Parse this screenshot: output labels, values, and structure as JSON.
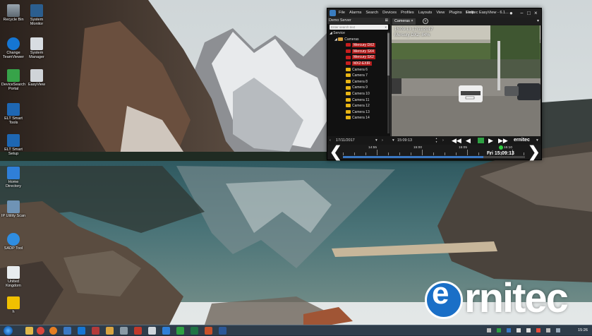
{
  "desktop": {
    "icons": [
      {
        "label": "Recycle Bin",
        "icon": "recycle-bin-icon"
      },
      {
        "label": "System Monitor",
        "icon": "monitor-icon"
      },
      {
        "label": "Change TeamViewer",
        "icon": "teamviewer-icon"
      },
      {
        "label": "System Manager",
        "icon": "system-manager-icon"
      },
      {
        "label": "DeviceSearch Portal",
        "icon": "device-search-icon"
      },
      {
        "label": "EasyView",
        "icon": "camera-icon"
      },
      {
        "label": "ELT Smart Tools",
        "icon": "tools-icon"
      },
      {
        "label": "ELT Smart Setup",
        "icon": "setup-icon"
      },
      {
        "label": "Home Directory",
        "icon": "home-icon"
      },
      {
        "label": "IP Utility Scan",
        "icon": "scanner-icon"
      },
      {
        "label": "SADP Tool",
        "icon": "sadp-icon"
      },
      {
        "label": "United Kingdom",
        "icon": "document-icon"
      },
      {
        "label": "h",
        "icon": "app-icon"
      }
    ]
  },
  "brand": {
    "logo_text": "ernitec",
    "initial": "e",
    "rest": "rnitec"
  },
  "window": {
    "menu": [
      "File",
      "Alarms",
      "Search",
      "Devices",
      "Profiles",
      "Layouts",
      "View",
      "Plugins",
      "Help"
    ],
    "title": "Ernitec EasyView - 6.1...",
    "controls": {
      "minimize": "−",
      "maximize": "□",
      "close": "×"
    },
    "tree": {
      "header": "Demo Server",
      "search_placeholder": "Enter search text",
      "search_clear": "×",
      "root": "Service",
      "folder": "Cameras",
      "cameras": [
        {
          "label": "Mercury DX2",
          "state": "active"
        },
        {
          "label": "Mercury SX4",
          "state": "active"
        },
        {
          "label": "Mercury SX2",
          "state": "active"
        },
        {
          "label": "MX2-EXIR",
          "state": "active"
        },
        {
          "label": "Camera 6",
          "state": "idle"
        },
        {
          "label": "Camera 7",
          "state": "idle"
        },
        {
          "label": "Camera 8",
          "state": "idle"
        },
        {
          "label": "Camera 9",
          "state": "idle"
        },
        {
          "label": "Camera 10",
          "state": "idle"
        },
        {
          "label": "Camera 11",
          "state": "idle"
        },
        {
          "label": "Camera 12",
          "state": "idle"
        },
        {
          "label": "Camera 13",
          "state": "idle"
        },
        {
          "label": "Camera 14",
          "state": "idle"
        }
      ]
    },
    "tab": {
      "label": "Cameras",
      "close": "×",
      "add": "+",
      "menu": "▾"
    },
    "video": {
      "osd_time": "15:09:13 17/11/2017",
      "osd_name": "Mercury DX2: 84%"
    },
    "playback": {
      "date": "17/11/2017",
      "time": "15:09:13",
      "prev_date": "‹",
      "date_menu": "▾",
      "next_date": "›",
      "time_menu": "▾",
      "step_up": "▲",
      "step_down": "▼",
      "next_time": "›",
      "buttons": {
        "rewind": "◀◀",
        "step_back": "◀",
        "play": "▶",
        "forward": "▶▶"
      },
      "logo": "ernitec",
      "logo_menu": "▾"
    },
    "timeline": {
      "labels": [
        "14:55",
        "15:00",
        "15:05",
        "15:10"
      ],
      "current": "Fri 15:09:13",
      "prev": "❮",
      "next": "❯",
      "progress": 0.77
    }
  },
  "taskbar": {
    "clock": "15:26",
    "pinned": [
      "explorer-icon",
      "chrome-icon",
      "firefox-icon",
      "media-icon",
      "teamviewer-icon",
      "easyview-icon",
      "folder-icon",
      "settings-icon",
      "office-icon",
      "terminal-icon",
      "network-icon",
      "green-app-icon",
      "excel-icon",
      "powerpoint-icon",
      "word-icon"
    ],
    "colors": {
      "taskbar": "#1e2d3c",
      "accent": "#3a78c4",
      "brand": "#1a6fc7",
      "active_camera": "#b31d1d",
      "idle_camera": "#e7b415"
    }
  }
}
